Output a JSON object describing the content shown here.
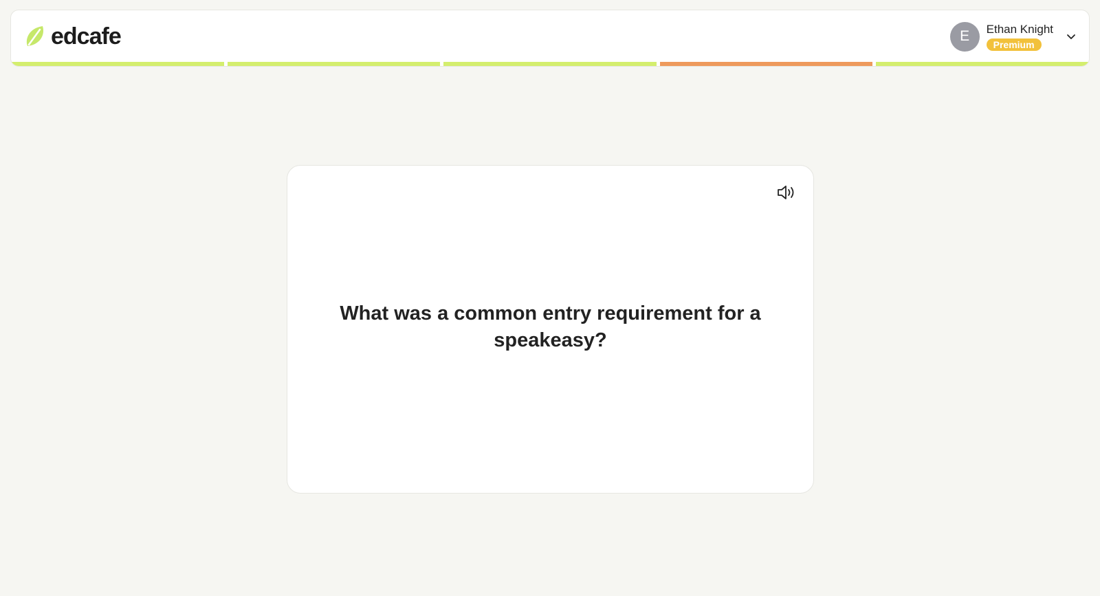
{
  "brand": {
    "name": "edcafe",
    "leaf_color": "#c6e86a"
  },
  "user": {
    "initial": "E",
    "name": "Ethan Knight",
    "plan": "Premium"
  },
  "progress": {
    "segments": [
      {
        "state": "done",
        "color": "#d4ee6e"
      },
      {
        "state": "done",
        "color": "#d4ee6e"
      },
      {
        "state": "done",
        "color": "#d4ee6e"
      },
      {
        "state": "current",
        "color": "#ee9a5c"
      },
      {
        "state": "done",
        "color": "#d4ee6e"
      }
    ]
  },
  "card": {
    "question": "What was a common entry requirement for a speakeasy?",
    "audio_icon": "speaker-icon"
  }
}
